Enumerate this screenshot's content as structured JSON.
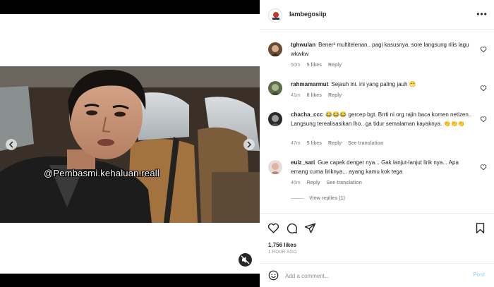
{
  "media": {
    "overlay_tag": "@Pembasmi.kehaluan.reall",
    "watermark": "",
    "prev_icon": "chevron-left-icon",
    "next_icon": "chevron-right-icon",
    "mute_icon": "sound-off-icon"
  },
  "header": {
    "username": "lambegosiip",
    "more_label": "•••"
  },
  "comments": [
    {
      "username": "tghwulan",
      "text": "Bener² multitelenan.. pagi kasusnya. sore langsung rilis lagu wkwkw",
      "time": "50m",
      "likes": "5 likes",
      "reply": "Reply",
      "translation": ""
    },
    {
      "username": "rahmamarmut",
      "text": "Sejauh ini. ini yang paling jauh 😁",
      "time": "41m",
      "likes": "8 likes",
      "reply": "Reply",
      "translation": ""
    },
    {
      "username": "chacha_ccc",
      "text": "😂😂😂 gercep bgt. Brrti ni org rajin baca komen netizen.. Langsung terealisasikan lho.. ga tidur semalaman kayaknya. 👏👏👏",
      "time": "47m",
      "likes": "5 likes",
      "reply": "Reply",
      "translation": "See translation"
    },
    {
      "username": "euiz_sari",
      "text": "Gue capek denger nya... Gak lanjut-lanjut lirik nya... Apa emang cuma liriknya... ayang kamu kok tega",
      "time": "46m",
      "likes": "",
      "reply": "Reply",
      "translation": "See translation"
    }
  ],
  "view_replies": "View replies (1)",
  "actions": {
    "like_icon": "heart-icon",
    "comment_icon": "comment-icon",
    "share_icon": "share-icon",
    "save_icon": "bookmark-icon"
  },
  "likes_count": "1,756 likes",
  "posted_time": "1 HOUR AGO",
  "add_comment": {
    "placeholder": "Add a comment...",
    "post_label": "Post"
  },
  "colors": {
    "text": "#262626",
    "muted": "#8e8e8e",
    "post_disabled": "#b3dbff",
    "border": "#efefef"
  }
}
